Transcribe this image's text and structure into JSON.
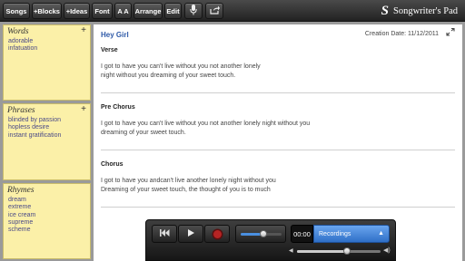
{
  "toolbar": {
    "songs_label": "Songs",
    "blocks_label": "+Blocks",
    "ideas_label": "+Ideas",
    "font_label": "Font",
    "font_size_label": "A A",
    "arrange_label": "Arrange",
    "edit_label": "Edit",
    "mic_icon": "microphone-icon",
    "share_icon": "share-icon",
    "brand_logo": "S",
    "brand_name": "Songwriter's Pad"
  },
  "sidebar": {
    "words": {
      "title": "Words",
      "add": "+",
      "items": [
        "adorable",
        "infatuation"
      ]
    },
    "phrases": {
      "title": "Phrases",
      "add": "+",
      "items": [
        "blinded by passion",
        "hopless desire",
        "instant gratification"
      ]
    },
    "rhymes": {
      "title": "Rhymes",
      "items": [
        "dream",
        "extreme",
        "ice cream",
        "supreme",
        "scheme"
      ]
    }
  },
  "song": {
    "title": "Hey Girl",
    "creation_date": "Creation Date: 11/12/2011",
    "sections": [
      {
        "title": "Verse",
        "lines": [
          "I got to have you  can't live without you not another lonely",
          "night without you dreaming of your sweet touch."
        ]
      },
      {
        "title": "Pre Chorus",
        "lines": [
          "I got to have you  can't live without you not another lonely night without you",
          "dreaming of your sweet touch."
        ]
      },
      {
        "title": "Chorus",
        "lines": [
          "I got to have you andcan't live  another lonely night without you",
          "Dreaming of your sweet touch, the thought of you is to much"
        ]
      }
    ]
  },
  "player": {
    "time": "00:00",
    "recordings_label": "Recordings",
    "position": 0.55,
    "volume": 0.6
  },
  "colors": {
    "accent": "#2f5aa8",
    "note_bg": "#fbf0a8",
    "record": "#b52424",
    "select": "#3a7ad4"
  }
}
